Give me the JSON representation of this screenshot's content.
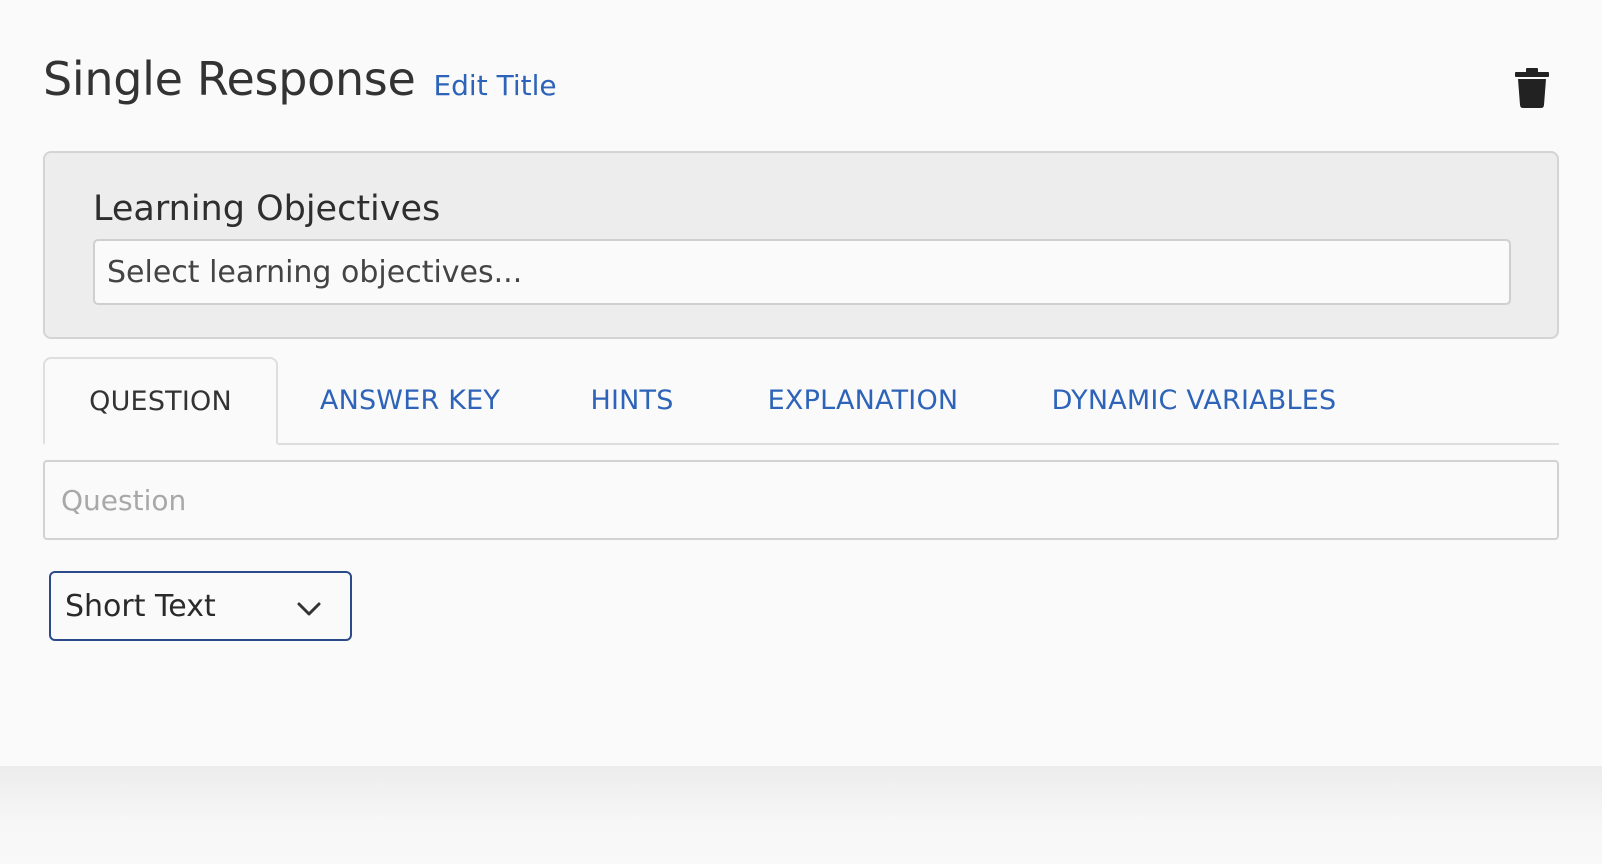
{
  "header": {
    "title": "Single Response",
    "edit_title_label": "Edit Title",
    "delete_icon": "trash-icon"
  },
  "learning_objectives": {
    "label": "Learning Objectives",
    "placeholder": "Select learning objectives..."
  },
  "tabs": [
    {
      "label": "QUESTION",
      "active": true
    },
    {
      "label": "ANSWER KEY",
      "active": false
    },
    {
      "label": "HINTS",
      "active": false
    },
    {
      "label": "EXPLANATION",
      "active": false
    },
    {
      "label": "DYNAMIC VARIABLES",
      "active": false
    }
  ],
  "question": {
    "placeholder": "Question"
  },
  "response_type": {
    "selected": "Short Text",
    "icon": "chevron-down-icon"
  },
  "colors": {
    "link": "#2d63b8",
    "text": "#333333",
    "select_border": "#2a4a8a"
  }
}
